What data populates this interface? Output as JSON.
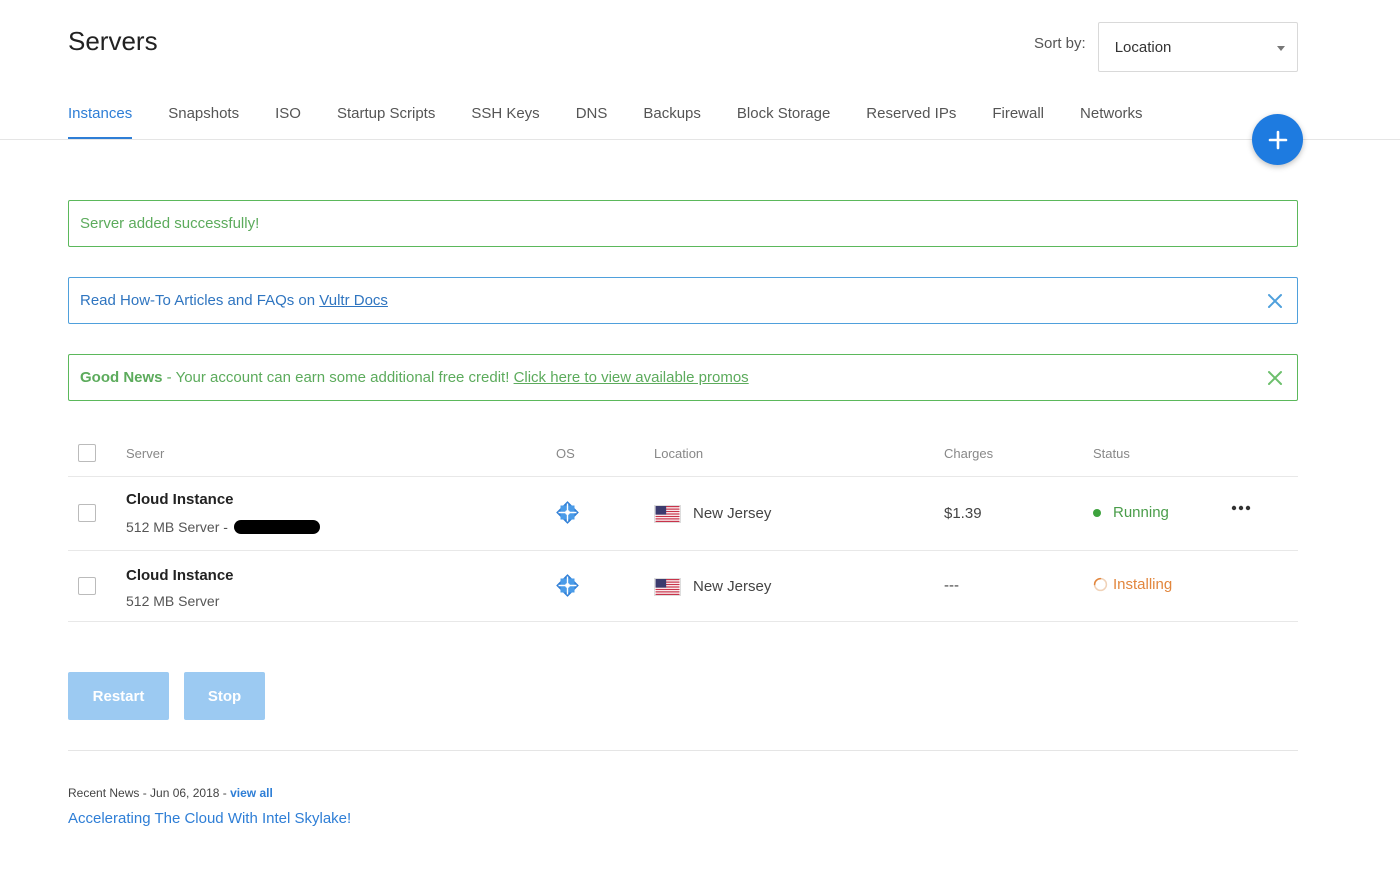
{
  "header": {
    "title": "Servers",
    "sort_label": "Sort by:",
    "sort_value": "Location"
  },
  "tabs": [
    {
      "label": "Instances",
      "active": true
    },
    {
      "label": "Snapshots"
    },
    {
      "label": "ISO"
    },
    {
      "label": "Startup Scripts"
    },
    {
      "label": "SSH Keys"
    },
    {
      "label": "DNS"
    },
    {
      "label": "Backups"
    },
    {
      "label": "Block Storage"
    },
    {
      "label": "Reserved IPs"
    },
    {
      "label": "Firewall"
    },
    {
      "label": "Networks"
    }
  ],
  "alerts": {
    "success": "Server added successfully!",
    "info_prefix": "Read How-To Articles and FAQs on ",
    "info_link": "Vultr Docs",
    "news_bold": "Good News",
    "news_text": " - Your account can earn some additional free credit! ",
    "news_link": "Click here to view available promos"
  },
  "table": {
    "headers": {
      "server": "Server",
      "os": "OS",
      "location": "Location",
      "charges": "Charges",
      "status": "Status"
    },
    "rows": [
      {
        "name": "Cloud Instance",
        "sub": "512 MB Server - ",
        "os_icon": "centos-icon",
        "flag": "us-flag",
        "location": "New Jersey",
        "charges": "$1.39",
        "status": "Running"
      },
      {
        "name": "Cloud Instance",
        "sub": "512 MB Server",
        "os_icon": "centos-icon",
        "flag": "us-flag",
        "location": "New Jersey",
        "charges": "---",
        "status": "Installing"
      }
    ]
  },
  "actions": {
    "restart": "Restart",
    "stop": "Stop"
  },
  "news": {
    "prefix": "Recent News - Jun 06, 2018 - ",
    "view_all": "view all",
    "title": "Accelerating The Cloud With Intel Skylake!"
  },
  "colors": {
    "accent": "#1e7be0",
    "success": "#5cab5c",
    "info": "#2f75c0",
    "running": "#3da33d",
    "installing": "#e2863d",
    "button_disabled": "#9ccaf2"
  }
}
